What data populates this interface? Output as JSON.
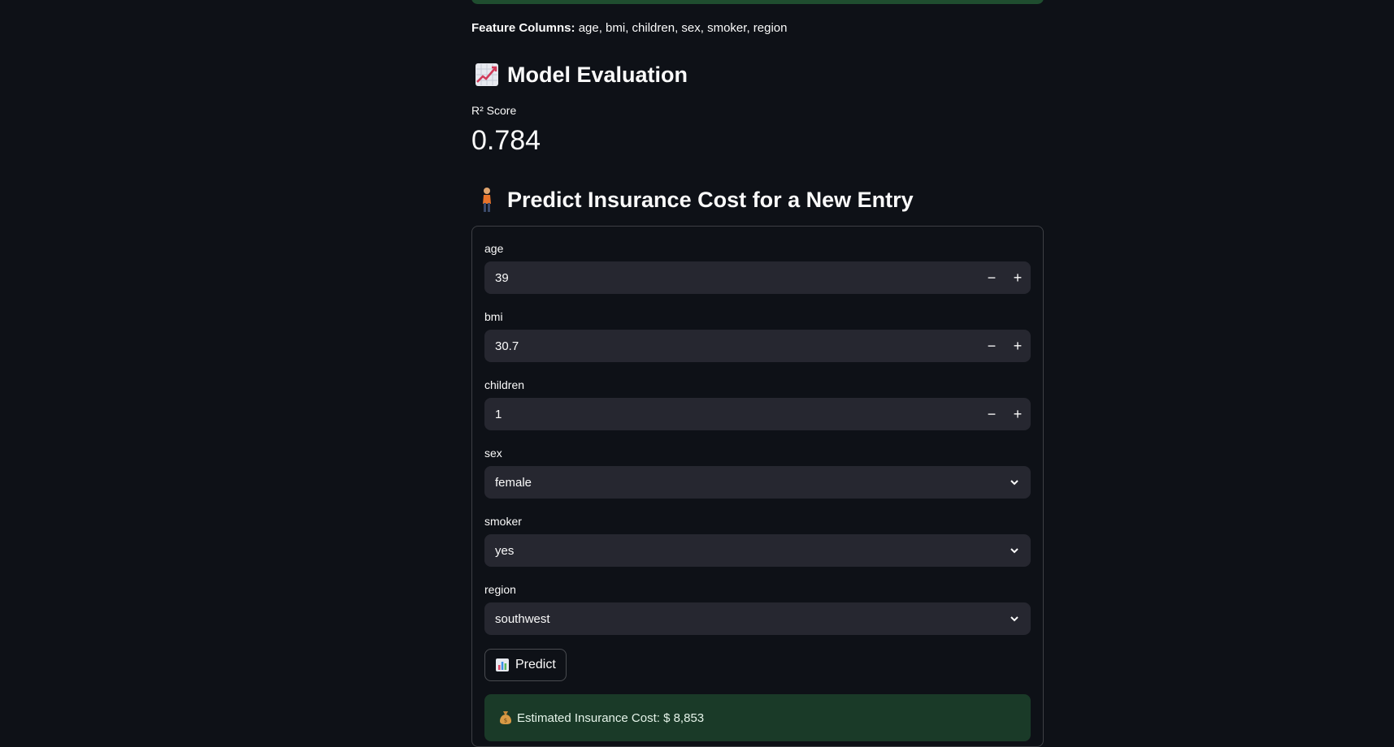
{
  "features": {
    "label": "Feature Columns:",
    "value": "age, bmi, children, sex, smoker, region"
  },
  "evaluation": {
    "heading": "Model Evaluation",
    "heading_icon": "chart-increasing-icon",
    "metric_label": "R² Score",
    "metric_value": "0.784"
  },
  "prediction": {
    "heading": "Predict Insurance Cost for a New Entry",
    "heading_icon": "person-standing-icon",
    "fields": {
      "age": {
        "label": "age",
        "value": "39"
      },
      "bmi": {
        "label": "bmi",
        "value": "30.7"
      },
      "children": {
        "label": "children",
        "value": "1"
      },
      "sex": {
        "label": "sex",
        "value": "female"
      },
      "smoker": {
        "label": "smoker",
        "value": "yes"
      },
      "region": {
        "label": "region",
        "value": "southwest"
      }
    },
    "stepper_minus": "−",
    "stepper_plus": "+",
    "button_label": "Predict",
    "button_icon": "bar-chart-icon",
    "result_text": "Estimated Insurance Cost: $ 8,853",
    "result_icon": "money-bag-icon"
  },
  "colors": {
    "background": "#0e1117",
    "input_bg": "#262730",
    "success_bg": "#1a3a28",
    "text": "#fafafa"
  }
}
